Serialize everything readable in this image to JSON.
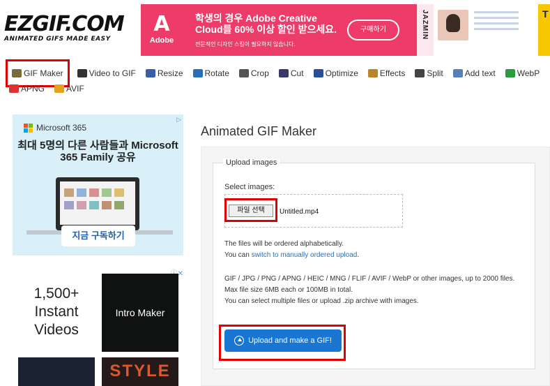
{
  "logo": {
    "main": "EZGIF.COM",
    "sub": "ANIMATED GIFS MADE EASY"
  },
  "top_ad": {
    "brand": "Adobe",
    "brand_glyph": "A",
    "headline": "학생의 경우 Adobe Creative Cloud를 60% 이상 할인 받으세요.",
    "subline": "전문적인 디자인 스킬이 필요하지 않습니다.",
    "button": "구매하기",
    "card_name": "JAZMIN",
    "corner_text": "T"
  },
  "toolbar": {
    "row1": [
      {
        "label": "GIF Maker",
        "icon": "gif-maker-icon",
        "color": "#7a6a3a",
        "active": true
      },
      {
        "label": "Video to GIF",
        "icon": "film-icon",
        "color": "#333333"
      },
      {
        "label": "Resize",
        "icon": "resize-icon",
        "color": "#3a5fa8"
      },
      {
        "label": "Rotate",
        "icon": "rotate-icon",
        "color": "#2a6fb6"
      },
      {
        "label": "Crop",
        "icon": "crop-icon",
        "color": "#555555"
      },
      {
        "label": "Cut",
        "icon": "cut-icon",
        "color": "#3a3a6a"
      },
      {
        "label": "Optimize",
        "icon": "optimize-icon",
        "color": "#2a4f9a"
      },
      {
        "label": "Effects",
        "icon": "effects-icon",
        "color": "#b8862b"
      },
      {
        "label": "Split",
        "icon": "split-icon",
        "color": "#444444"
      },
      {
        "label": "Add text",
        "icon": "add-text-icon",
        "color": "#5a7fb8"
      },
      {
        "label": "WebP",
        "icon": "webp-icon",
        "color": "#2e9a3e"
      }
    ],
    "row2": [
      {
        "label": "APNG",
        "icon": "apng-icon",
        "color": "#e03030"
      },
      {
        "label": "AVIF",
        "icon": "avif-icon",
        "color": "#e8a11c"
      }
    ]
  },
  "ms_ad": {
    "brand": "Microsoft 365",
    "title": "최대 5명의 다른 사람들과 Microsoft 365 Family 공유",
    "cta": "지금 구독하기",
    "adchoice": "▷"
  },
  "video_ad": {
    "big_text": "1,500+ Instant Videos",
    "tile_label": "Intro Maker",
    "tile3_label": "STYLE",
    "adchoice": "ⓘ✕"
  },
  "main": {
    "title": "Animated GIF Maker",
    "legend": "Upload images",
    "select_label": "Select images:",
    "file_button": "파일 선택",
    "file_name": "Untitled.mp4",
    "info_line1": "The files will be ordered alphabetically.",
    "info_line2_prefix": "You can ",
    "info_line2_link": "switch to manually ordered upload",
    "info_line2_suffix": ".",
    "formats": "GIF / JPG / PNG / APNG / HEIC / MNG / FLIF / AVIF / WebP or other images, up to 2000 files.",
    "max_size": "Max file size 6MB each or 100MB in total.",
    "multi": "You can select multiple files or upload .zip archive with images.",
    "upload_button": "Upload and make a GIF!"
  },
  "colors": {
    "red_highlight": "#e00000",
    "primary_button": "#1976d2",
    "link": "#2a6fb6",
    "ad_pink": "#ee3c6a"
  }
}
